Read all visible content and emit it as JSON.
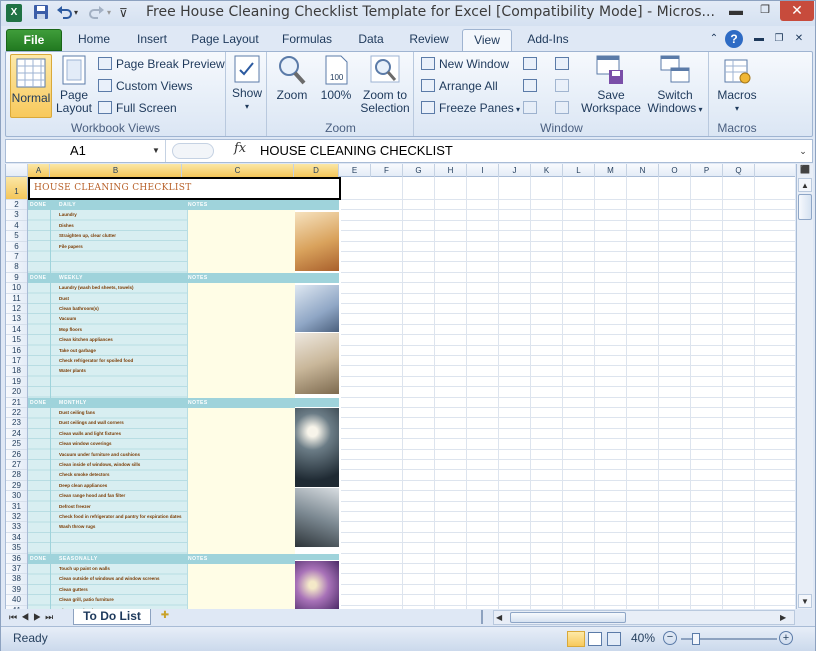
{
  "window": {
    "title": "Free House Cleaning Checklist Template for Excel  [Compatibility Mode]  -  Micros..."
  },
  "tabs": [
    {
      "label": "File"
    },
    {
      "label": "Home"
    },
    {
      "label": "Insert"
    },
    {
      "label": "Page Layout"
    },
    {
      "label": "Formulas"
    },
    {
      "label": "Data"
    },
    {
      "label": "Review"
    },
    {
      "label": "View"
    },
    {
      "label": "Add-Ins"
    }
  ],
  "ribbon": {
    "workbook_views": {
      "label": "Workbook Views",
      "normal": "Normal",
      "page_layout_1": "Page",
      "page_layout_2": "Layout",
      "page_break_preview": "Page Break Preview",
      "custom_views": "Custom Views",
      "full_screen": "Full Screen"
    },
    "show": {
      "label": "Show"
    },
    "zoom": {
      "label": "Zoom",
      "zoom": "Zoom",
      "hundred": "100%",
      "zoom_to_selection_1": "Zoom to",
      "zoom_to_selection_2": "Selection"
    },
    "window": {
      "label": "Window",
      "new_window": "New Window",
      "arrange_all": "Arrange All",
      "freeze_panes": "Freeze Panes",
      "save_workspace_1": "Save",
      "save_workspace_2": "Workspace",
      "switch_windows_1": "Switch",
      "switch_windows_2": "Windows"
    },
    "macros": {
      "label": "Macros",
      "macros": "Macros"
    }
  },
  "formula_bar": {
    "name_box": "A1",
    "fx": "fx",
    "value": "HOUSE CLEANING CHECKLIST"
  },
  "columns": [
    "A",
    "B",
    "C",
    "D",
    "E",
    "F",
    "G",
    "H",
    "I",
    "J",
    "K",
    "L",
    "M",
    "N",
    "O",
    "P",
    "Q"
  ],
  "rows": [
    "1",
    "2",
    "3",
    "4",
    "5",
    "6",
    "7",
    "8",
    "9",
    "10",
    "11",
    "12",
    "13",
    "14",
    "15",
    "16",
    "17",
    "18",
    "19",
    "20",
    "21",
    "22",
    "23",
    "24",
    "25",
    "26",
    "27",
    "28",
    "29",
    "30",
    "31",
    "32",
    "33",
    "34",
    "35",
    "36",
    "37",
    "38",
    "39",
    "40",
    "41"
  ],
  "sheet": {
    "title": "HOUSE CLEANING CHECKLIST",
    "sections": [
      {
        "done": "DONE",
        "name": "DAILY",
        "notes": "NOTES",
        "tasks": [
          "Laundry",
          "Dishes",
          "Straighten up, clear clutter",
          "File papers"
        ]
      },
      {
        "done": "DONE",
        "name": "WEEKLY",
        "notes": "NOTES",
        "tasks": [
          "Laundry (wash bed sheets, towels)",
          "Dust",
          "Clean bathroom(s)",
          "Vacuum",
          "Mop floors",
          "Clean kitchen appliances",
          "Take out garbage",
          "Check refrigerator for spoiled food",
          "Water plants"
        ]
      },
      {
        "done": "DONE",
        "name": "MONTHLY",
        "notes": "NOTES",
        "tasks": [
          "Dust ceiling fans",
          "Dust ceilings and wall corners",
          "Clean walls and light fixtures",
          "Clean window coverings",
          "Vacuum under furniture and cushions",
          "Clean inside of windows, window sills",
          "Check smoke detectors",
          "Deep clean appliances",
          "Clean range hood and fan filter",
          "Defrost freezer",
          "Check food in refrigerator and pantry for expiration dates",
          "Wash throw rugs"
        ]
      },
      {
        "done": "DONE",
        "name": "SEASONALLY",
        "notes": "NOTES",
        "tasks": [
          "Touch up paint on walls",
          "Clean outside of windows and window screens",
          "Clean gutters",
          "Clean grill, patio furniture",
          "Clean exterior doors"
        ]
      }
    ]
  },
  "sheet_tabs": [
    {
      "label": "To Do List"
    }
  ],
  "status": {
    "ready": "Ready",
    "zoom": "40%"
  }
}
